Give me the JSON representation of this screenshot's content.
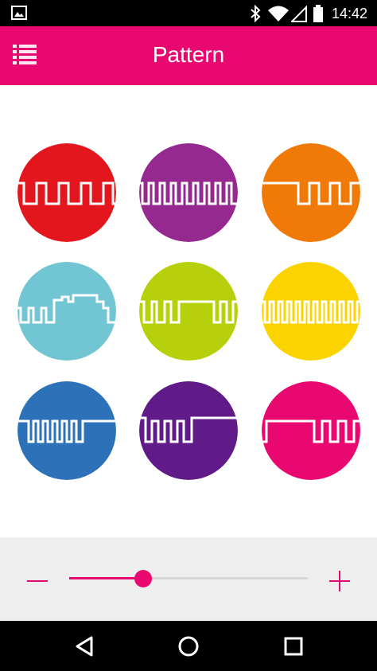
{
  "status_bar": {
    "time": "14:42",
    "icons": [
      "image-icon",
      "bluetooth-icon",
      "wifi-icon",
      "signal-icon",
      "battery-icon"
    ]
  },
  "app_bar": {
    "title": "Pattern",
    "menu_icon": "list-menu-icon",
    "color": "#e8086f"
  },
  "patterns": [
    {
      "name": "red-pattern",
      "color": "#e3161d"
    },
    {
      "name": "purple-pattern",
      "color": "#96298f"
    },
    {
      "name": "orange-pattern",
      "color": "#f07a07"
    },
    {
      "name": "light-blue-pattern",
      "color": "#72c6d3"
    },
    {
      "name": "lime-pattern",
      "color": "#b6d10c"
    },
    {
      "name": "yellow-pattern",
      "color": "#fbd400"
    },
    {
      "name": "blue-pattern",
      "color": "#2d72b9"
    },
    {
      "name": "dark-purple-pattern",
      "color": "#601b89"
    },
    {
      "name": "pink-pattern",
      "color": "#e8086f"
    }
  ],
  "slider": {
    "value": 0.31
  },
  "nav_bar": {
    "icons": [
      "back-icon",
      "home-icon",
      "recents-icon"
    ]
  }
}
